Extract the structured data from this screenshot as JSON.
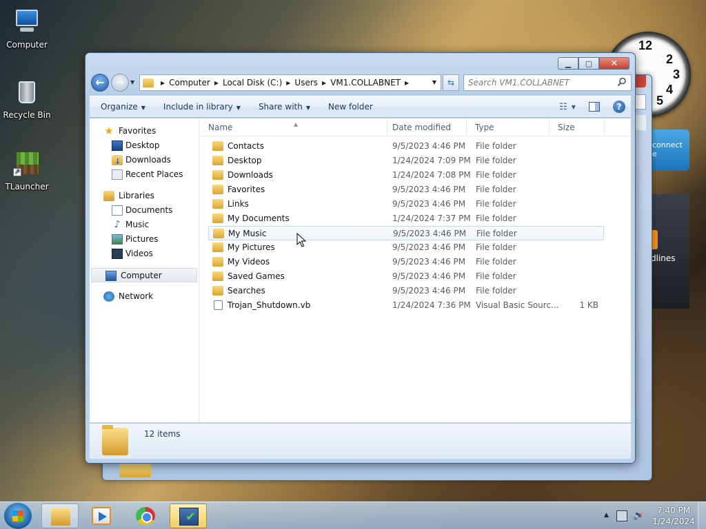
{
  "desktop": {
    "icons": [
      {
        "label": "Computer"
      },
      {
        "label": "Recycle Bin"
      },
      {
        "label": "TLauncher"
      }
    ],
    "gadgets": {
      "clock_numbers": [
        "12",
        "2",
        "3",
        "4",
        "5"
      ],
      "connect_text": "connect\ne",
      "news_text": "dlines"
    }
  },
  "window": {
    "caption": {
      "minimize": "▁",
      "maximize": "▢",
      "close": "✕"
    },
    "address": {
      "crumbs": [
        "Computer",
        "Local Disk (C:)",
        "Users",
        "VM1.COLLABNET"
      ]
    },
    "search": {
      "placeholder": "Search VM1.COLLABNET"
    },
    "toolbar": {
      "organize": "Organize",
      "include_in_library": "Include in library",
      "share_with": "Share with",
      "new_folder": "New folder"
    },
    "nav": {
      "favorites": {
        "label": "Favorites",
        "items": [
          "Desktop",
          "Downloads",
          "Recent Places"
        ]
      },
      "libraries": {
        "label": "Libraries",
        "items": [
          "Documents",
          "Music",
          "Pictures",
          "Videos"
        ]
      },
      "computer": "Computer",
      "network": "Network"
    },
    "columns": {
      "name": "Name",
      "date": "Date modified",
      "type": "Type",
      "size": "Size"
    },
    "files": [
      {
        "name": "Contacts",
        "date": "9/5/2023 4:46 PM",
        "type": "File folder",
        "size": ""
      },
      {
        "name": "Desktop",
        "date": "1/24/2024 7:09 PM",
        "type": "File folder",
        "size": ""
      },
      {
        "name": "Downloads",
        "date": "1/24/2024 7:08 PM",
        "type": "File folder",
        "size": ""
      },
      {
        "name": "Favorites",
        "date": "9/5/2023 4:46 PM",
        "type": "File folder",
        "size": ""
      },
      {
        "name": "Links",
        "date": "9/5/2023 4:46 PM",
        "type": "File folder",
        "size": ""
      },
      {
        "name": "My Documents",
        "date": "1/24/2024 7:37 PM",
        "type": "File folder",
        "size": ""
      },
      {
        "name": "My Music",
        "date": "9/5/2023 4:46 PM",
        "type": "File folder",
        "size": ""
      },
      {
        "name": "My Pictures",
        "date": "9/5/2023 4:46 PM",
        "type": "File folder",
        "size": ""
      },
      {
        "name": "My Videos",
        "date": "9/5/2023 4:46 PM",
        "type": "File folder",
        "size": ""
      },
      {
        "name": "Saved Games",
        "date": "9/5/2023 4:46 PM",
        "type": "File folder",
        "size": ""
      },
      {
        "name": "Searches",
        "date": "9/5/2023 4:46 PM",
        "type": "File folder",
        "size": ""
      },
      {
        "name": "Trojan_Shutdown.vb",
        "date": "1/24/2024 7:36 PM",
        "type": "Visual Basic Sourc...",
        "size": "1 KB"
      }
    ],
    "details": {
      "item_count": "12 items"
    }
  },
  "taskbar": {
    "tasks": [
      {
        "icon": "windows-explorer-icon",
        "active": true
      },
      {
        "icon": "media-player-icon",
        "active": false
      },
      {
        "icon": "chrome-icon",
        "active": false
      },
      {
        "icon": "installer-icon",
        "active": true
      }
    ],
    "clock": {
      "time": "7:40 PM",
      "date": "1/24/2024"
    }
  }
}
